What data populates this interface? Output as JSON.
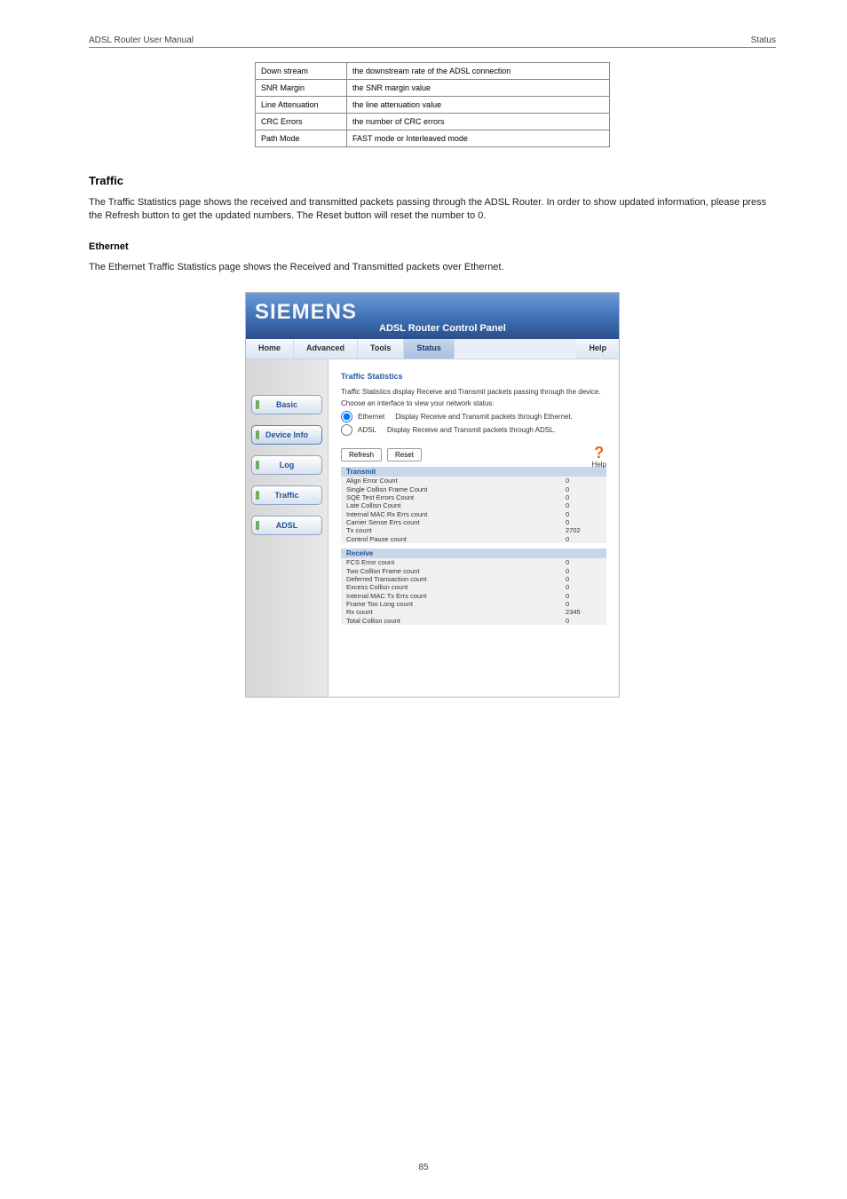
{
  "header": {
    "left": "ADSL Router User Manual",
    "right": "Status"
  },
  "info_table": [
    [
      "Down stream",
      "the downstream rate of the ADSL connection"
    ],
    [
      "SNR Margin",
      "the SNR margin value"
    ],
    [
      "Line Attenuation",
      "the line attenuation value"
    ],
    [
      "CRC Errors",
      "the number of CRC errors"
    ],
    [
      "Path Mode",
      "FAST mode or Interleaved mode"
    ]
  ],
  "headings": {
    "traffic": "Traffic",
    "ethernet": "Ethernet"
  },
  "paragraphs": {
    "traffic_intro": "The Traffic Statistics page shows the received and transmitted packets passing through the ADSL Router. In order to show updated information, please press the Refresh button to get the updated numbers. The Reset button will reset the number to 0.",
    "ethernet_intro": "The Ethernet Traffic Statistics page shows the Received and Transmitted packets over Ethernet."
  },
  "router": {
    "brand": "SIEMENS",
    "panel_title": "ADSL Router Control Panel",
    "nav": {
      "home": "Home",
      "advanced": "Advanced",
      "tools": "Tools",
      "status": "Status",
      "help": "Help"
    },
    "sidebar": {
      "basic": "Basic",
      "device": "Device Info",
      "log": "Log",
      "traffic": "Traffic",
      "adsl": "ADSL"
    },
    "content": {
      "title": "Traffic Statistics",
      "description": "Traffic Statistics display Receive and Transmit packets passing through the device.",
      "choose_label": "Choose an interface to view your network status:",
      "ethernet_label": "Ethernet",
      "ethernet_desc": "Display Receive and Transmit packets through Ethernet.",
      "adsl_label": "ADSL",
      "adsl_desc": "Display Receive and Transmit packets through ADSL.",
      "refresh_btn": "Refresh",
      "reset_btn": "Reset",
      "help_label": "Help",
      "transmit_header": "Transmit",
      "receive_header": "Receive",
      "transmit_rows": [
        [
          "Align Error Count",
          "0"
        ],
        [
          "Single Collisn Frame Count",
          "0"
        ],
        [
          "SQE Test Errors Count",
          "0"
        ],
        [
          "Late Collisn Count",
          "0"
        ],
        [
          "Internal MAC Rx Errs count",
          "0"
        ],
        [
          "Carrier Sense Errs count",
          "0"
        ],
        [
          "Tx count",
          "2702"
        ],
        [
          "Control Pause count",
          "0"
        ]
      ],
      "receive_rows": [
        [
          "FCS Error count",
          "0"
        ],
        [
          "Two Collisn Frame count",
          "0"
        ],
        [
          "Deferred Transaction count",
          "0"
        ],
        [
          "Excess Collisn count",
          "0"
        ],
        [
          "Internal MAC Tx Errs count",
          "0"
        ],
        [
          "Frame Too Long count",
          "0"
        ],
        [
          "Rx count",
          "2345"
        ],
        [
          "Total Collisn count",
          "0"
        ]
      ]
    }
  },
  "page_number": "85"
}
